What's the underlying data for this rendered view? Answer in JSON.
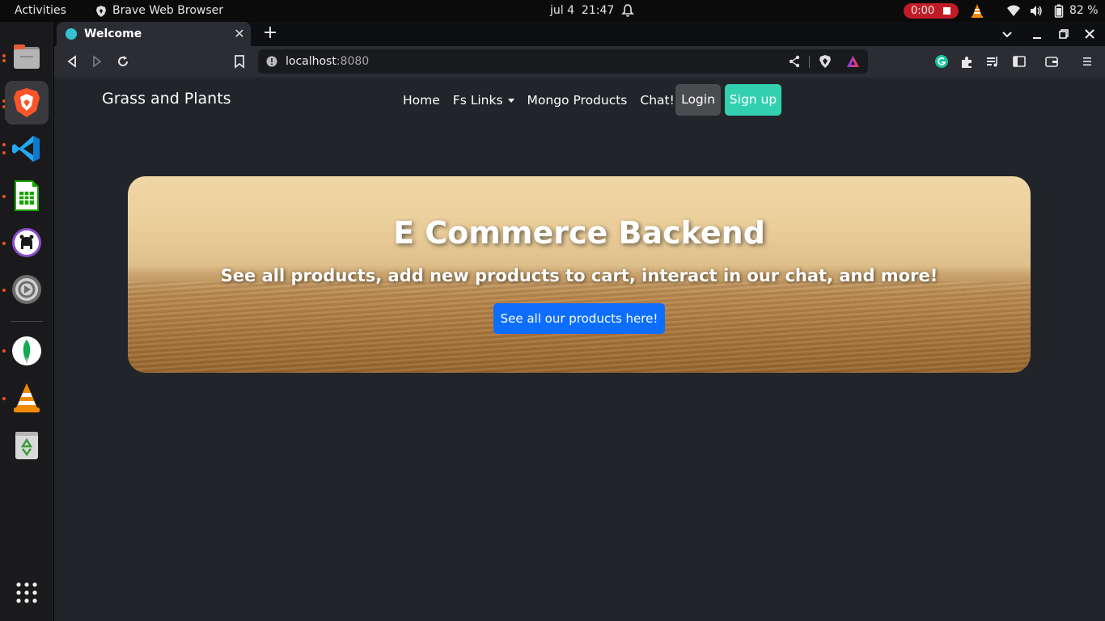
{
  "topbar": {
    "activities": "Activities",
    "app_name": "Brave Web Browser",
    "date": "jul 4",
    "time": "21:47",
    "recording_time": "0:00",
    "battery": "82 %"
  },
  "dock": {
    "apps": [
      "files-icon",
      "brave-icon",
      "vscode-icon",
      "libreoffice-calc-icon",
      "github-desktop-icon",
      "settings-icon",
      "mongodb-compass-icon",
      "vlc-icon",
      "trash-icon"
    ]
  },
  "browser": {
    "tab_title": "Welcome",
    "url_host": "localhost",
    "url_port": ":8080"
  },
  "page": {
    "brand": "Grass and Plants",
    "nav": {
      "home": "Home",
      "fs_links": "Fs Links",
      "mongo_products": "Mongo Products",
      "chat": "Chat!"
    },
    "login": "Login",
    "signup": "Sign up",
    "hero": {
      "title": "E Commerce Backend",
      "subtitle": "See all products, add new products to cart, interact in our chat, and more!",
      "button": "See all our products here!"
    }
  },
  "colors": {
    "accent_blue": "#0d6efd",
    "signup_teal": "#33d0b0",
    "login_gray": "#4b4c4f",
    "page_bg": "#212529",
    "rec_red": "#c01c28"
  }
}
